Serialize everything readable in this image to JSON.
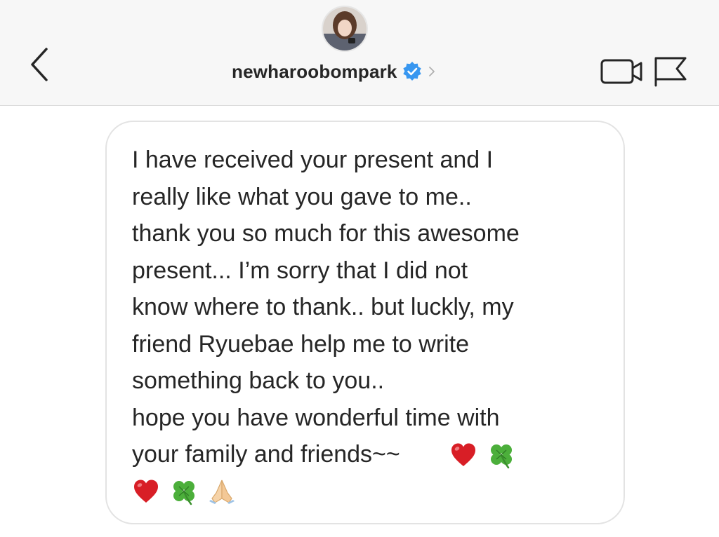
{
  "header": {
    "username": "newharoobompark",
    "back_icon": "chevron-left-icon",
    "verified_icon": "verified-badge-icon",
    "video_icon": "video-call-icon",
    "flag_icon": "flag-icon",
    "colors": {
      "header_bg": "#f7f7f7",
      "verified_blue": "#3897f0",
      "text": "#262626"
    }
  },
  "message": {
    "text": "I have received your present and I\nreally like what you gave to me..\nthank you so much for this awesome\npresent... I’m sorry that I did not\nknow where to thank.. but luckly, my\nfriend Ryuebae help me to write\nsomething back to you..\nhope you have wonderful time with\nyour family and friends~~",
    "emojis_line1": [
      "heart-emoji",
      "four-leaf-clover-emoji"
    ],
    "emojis_line2": [
      "heart-emoji",
      "four-leaf-clover-emoji",
      "folded-hands-emoji"
    ]
  }
}
